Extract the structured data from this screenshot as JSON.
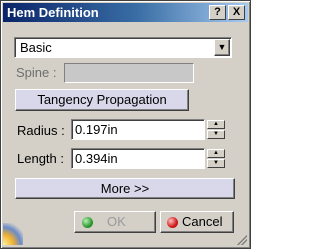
{
  "window": {
    "title": "Hem Definition",
    "help_glyph": "?",
    "close_glyph": "X"
  },
  "type_combo": {
    "selected": "Basic",
    "arrow_glyph": "▼"
  },
  "spine": {
    "label": "Spine :",
    "value": ""
  },
  "tangency_button": {
    "label": "Tangency Propagation"
  },
  "radius": {
    "label": "Radius :",
    "value": "0.197in"
  },
  "length": {
    "label": "Length :",
    "value": "0.394in"
  },
  "more_button": {
    "label": "More >>"
  },
  "ok_button": {
    "label": "OK",
    "icon": "green-dot-icon"
  },
  "cancel_button": {
    "label": "Cancel",
    "icon": "red-dot-icon"
  },
  "colors": {
    "title_start": "#0a246a",
    "title_end": "#a6caf0",
    "dialog_bg": "#d4d0c8",
    "button_tint": "#d8d8ea"
  }
}
